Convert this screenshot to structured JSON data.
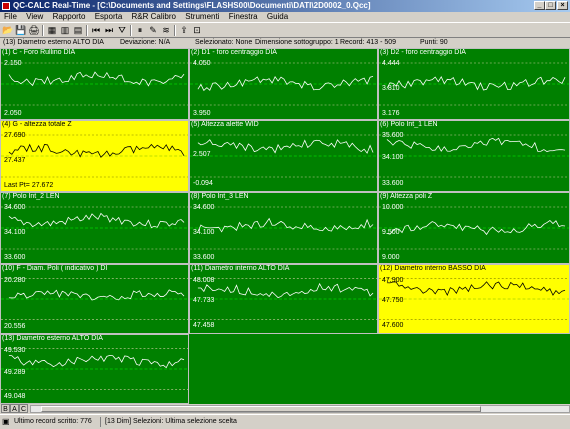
{
  "window": {
    "title": "QC-CALC Real-Time - [C:\\Documents and Settings\\FLASHS00\\Documenti\\DATI\\2D0002_0.Qcc]"
  },
  "menu": [
    "File",
    "View",
    "Rapporto",
    "Esporta",
    "R&R Calibro",
    "Strumenti",
    "Finestra",
    "Guida"
  ],
  "header": {
    "dimension": "(13) Diametro esterno ALTO DIA",
    "deviation": "Deviazione: N/A",
    "selected": "Selezionato: None",
    "subgroup": "Dimensione sottogruppo: 1",
    "record": "Record: 413 - 509",
    "points": "Punti: 90"
  },
  "colors": {
    "green": "#008000",
    "yellow": "#ffff00",
    "series_on_green": "#ffffff",
    "series_on_yellow": "#000000",
    "center_line": "#00ff00",
    "limit_line": "#d0d0a0"
  },
  "panels": [
    {
      "title": "(1) C - Foro Rullino DIA",
      "top": "2.150",
      "mid": "",
      "bottom": "2.050",
      "highlight": false
    },
    {
      "title": "(2) D1 - foro centraggio DIA",
      "top": "4.050",
      "mid": "",
      "bottom": "3.950",
      "highlight": false
    },
    {
      "title": "(3) D2 - foro centraggio DIA",
      "top": "4.444",
      "mid": "3.810",
      "bottom": "3.176",
      "highlight": false
    },
    {
      "title": "(4) G - altezza totale Z",
      "top": "27.690",
      "mid": "27.437",
      "bottom": "",
      "footer": "Last Pt= 27.672",
      "highlight": true
    },
    {
      "title": "(5) Altezza alette WID",
      "top": "",
      "mid": "2.507",
      "bottom": "-0.094",
      "highlight": false
    },
    {
      "title": "(6) Polo Int_1 LEN",
      "top": "35.600",
      "mid": "34.100",
      "bottom": "33.600",
      "highlight": false
    },
    {
      "title": "(7) Polo Int_2 LEN",
      "top": "34.600",
      "mid": "34.100",
      "bottom": "33.600",
      "highlight": false
    },
    {
      "title": "(8) Polo Int_3 LEN",
      "top": "34.600",
      "mid": "34.100",
      "bottom": "33.600",
      "highlight": false
    },
    {
      "title": "(9) Altezza poli Z",
      "top": "10.000",
      "mid": "9.500",
      "bottom": "9.000",
      "highlight": false
    },
    {
      "title": "(10) F - Diam. Poli ( indicativo ) DI",
      "top": "20.280",
      "mid": "",
      "bottom": "20.556",
      "highlight": false
    },
    {
      "title": "(11) Diametro interno ALTO DIA",
      "top": "48.008",
      "mid": "47.733",
      "bottom": "47.458",
      "highlight": false
    },
    {
      "title": "(12) Diametro interno BASSO DIA",
      "top": "47.900",
      "mid": "47.750",
      "bottom": "47.600",
      "highlight": true
    },
    {
      "title": "(13) Diametro esterno ALTO DIA",
      "top": "49.530",
      "mid": "49.289",
      "bottom": "49.048",
      "highlight": false
    }
  ],
  "tabs": [
    "B",
    "A",
    "C"
  ],
  "status": {
    "last_record": "Ultimo record scritto: 776",
    "selection": "[13 Dim] Selezioni: Ultima selezione scelta"
  }
}
